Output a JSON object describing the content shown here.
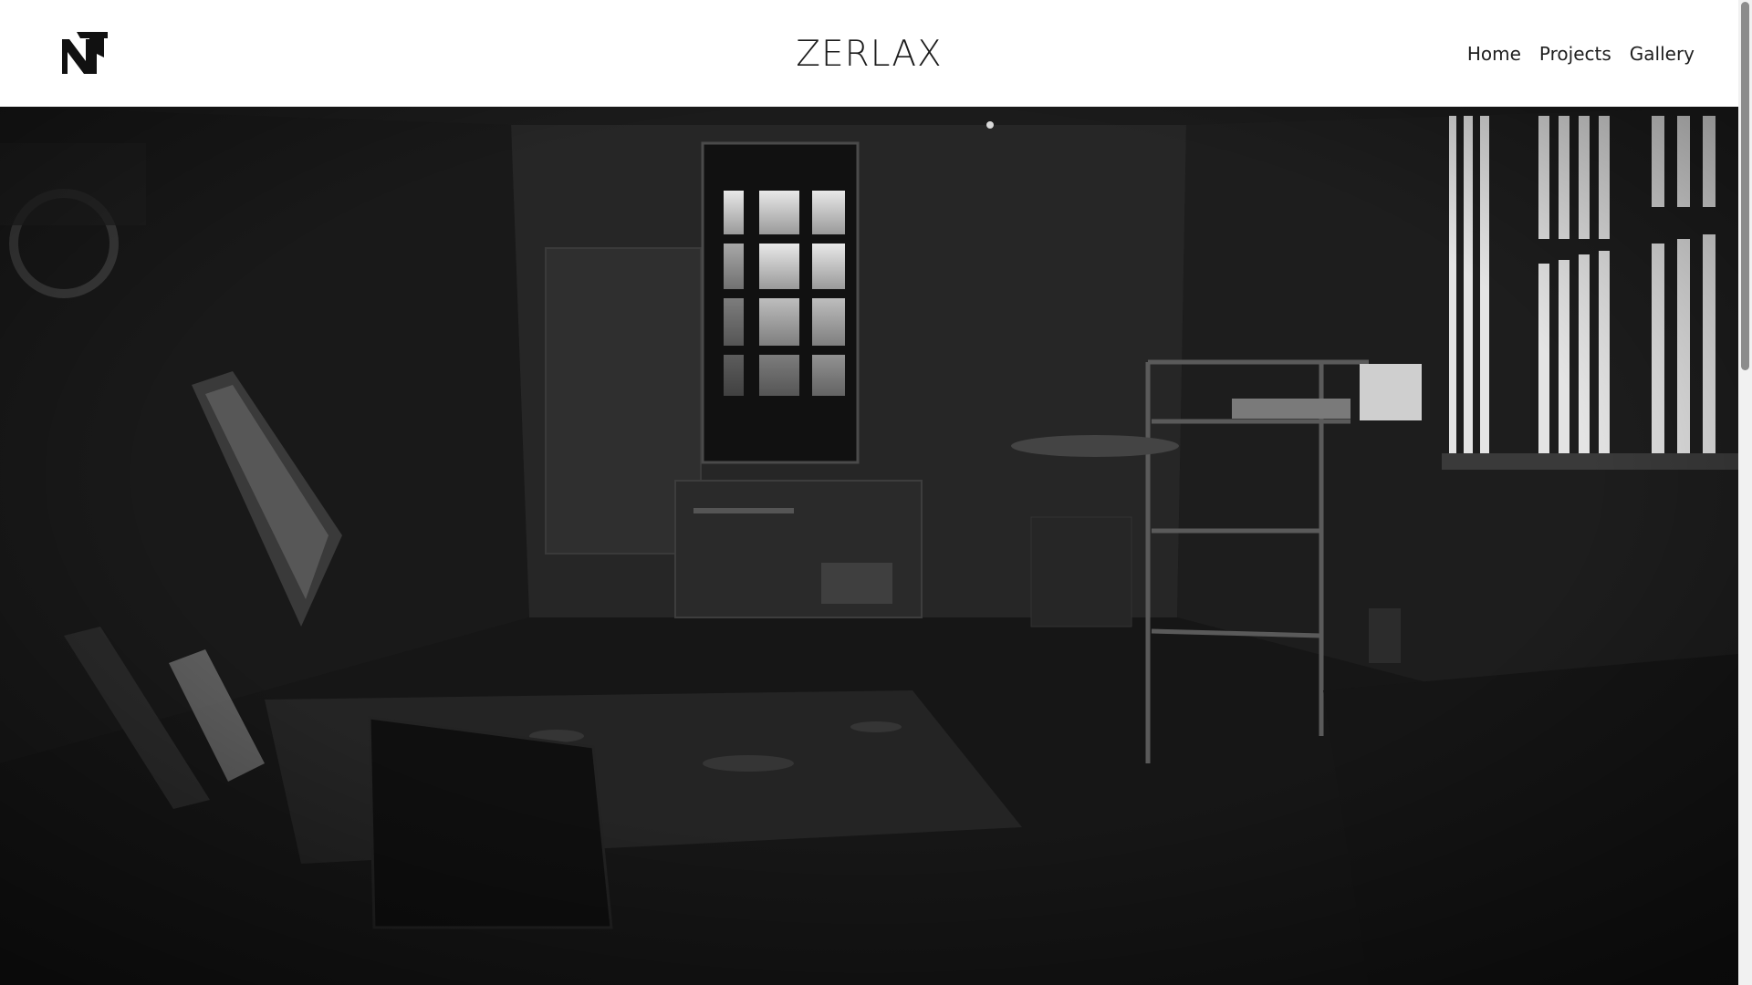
{
  "header": {
    "logo_icon": "nt-monogram-logo",
    "site_title": "ZERLAX"
  },
  "nav": {
    "items": [
      {
        "label": "Home"
      },
      {
        "label": "Projects"
      },
      {
        "label": "Gallery"
      }
    ]
  },
  "hero": {
    "image": "dark-abandoned-room-illustration"
  },
  "colors": {
    "header_bg": "#ffffff",
    "text": "#1f1f1f",
    "hero_dark": "#121212"
  }
}
